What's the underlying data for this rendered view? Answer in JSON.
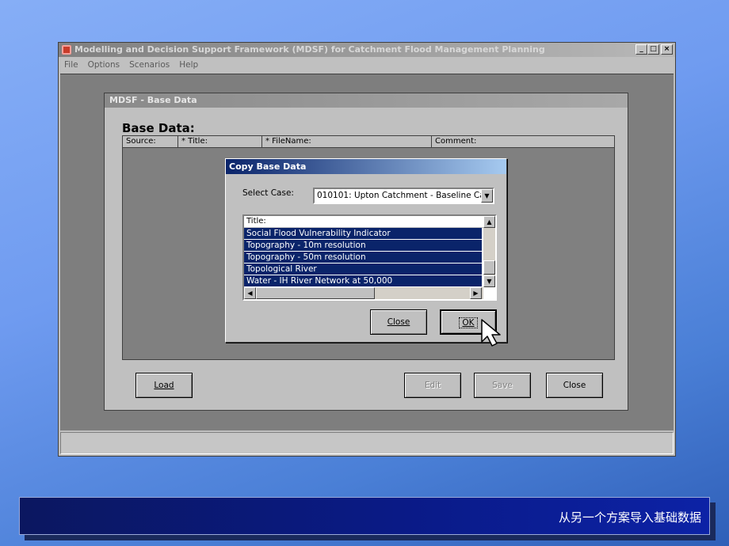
{
  "main_window": {
    "title": "Modelling and Decision Support Framework (MDSF) for Catchment Flood Management Planning",
    "caption_buttons": [
      "_",
      "□",
      "×"
    ],
    "menu": [
      "File",
      "Options",
      "Scenarios",
      "Help"
    ]
  },
  "base_window": {
    "title": "MDSF - Base Data",
    "heading": "Base Data:",
    "columns": [
      "Source:",
      "* Title:",
      "* FileName:",
      "Comment:"
    ],
    "buttons": {
      "load": "Load",
      "edit": "Edit",
      "save": "Save",
      "close": "Close"
    }
  },
  "dialog": {
    "title": "Copy Base Data",
    "select_label": "Select Case:",
    "select_value": "010101: Upton Catchment - Baseline Ca",
    "list_header": "Title:",
    "list_items": [
      "Social Flood Vulnerability Indicator",
      "Topography - 10m resolution",
      "Topography - 50m resolution",
      "Topological River",
      "Water - IH River Network at 50,000"
    ],
    "buttons": {
      "close": "Close",
      "ok": "OK"
    }
  },
  "banner": {
    "text": "从另一个方案导入基础数据"
  },
  "icons": [
    "app-icon",
    "dropdown-arrow-icon",
    "scroll-up-icon",
    "scroll-down-icon",
    "scroll-left-icon",
    "scroll-right-icon",
    "mouse-pointer-icon"
  ]
}
